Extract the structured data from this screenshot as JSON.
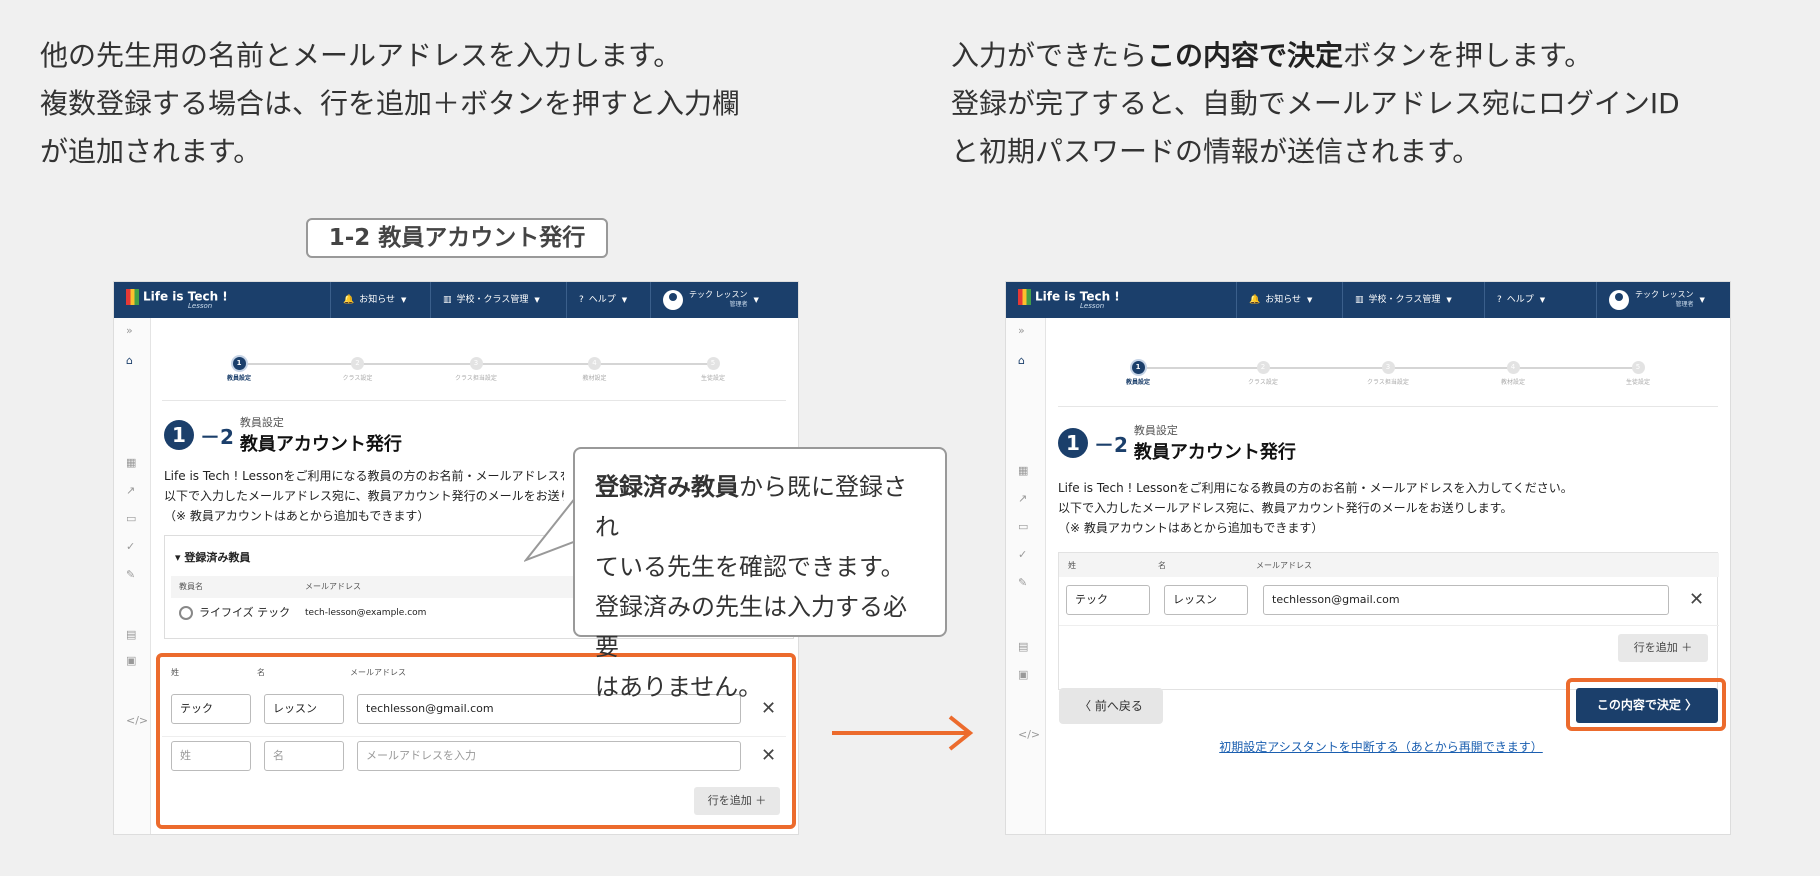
{
  "left_caption": {
    "line1": "他の先生用の名前とメールアドレスを入力します。",
    "line2": "複数登録する場合は、行を追加＋ボタンを押すと入力欄",
    "line3": "が追加されます。"
  },
  "right_caption": {
    "line1_pre": "入力ができたら",
    "line1_bold": "この内容で決定",
    "line1_post": "ボタンを押します。",
    "line2": "登録が完了すると、自動でメールアドレス宛にログインID",
    "line3": "と初期パスワードの情報が送信されます。"
  },
  "section_tag": "1-2 教員アカウント発行",
  "app": {
    "logo_text": "Life is Tech !",
    "logo_sub": "Lesson",
    "nav": {
      "notifications": "お知らせ",
      "school_class": "学校・クラス管理",
      "help": "ヘルプ",
      "user_name": "テック レッスン",
      "user_role": "管理者"
    },
    "steps": [
      {
        "num": "1",
        "label": "教員設定"
      },
      {
        "num": "2",
        "label": "クラス設定"
      },
      {
        "num": "3",
        "label": "クラス担当設定"
      },
      {
        "num": "4",
        "label": "教材設定"
      },
      {
        "num": "5",
        "label": "生徒設定"
      }
    ],
    "heading": {
      "num": "1",
      "dash": "－",
      "num2": "2",
      "sub": "教員設定",
      "title": "教員アカウント発行"
    },
    "desc": {
      "line1": "Life is Tech ! Lessonをご利用になる教員の方のお名前・メールアドレスを入力してください。",
      "line2": "以下で入力したメールアドレス宛に、教員アカウント発行のメールをお送りします。",
      "line3": "（※ 教員アカウントはあとから追加もできます）"
    },
    "registered": {
      "title": "▾ 登録済み教員",
      "col_name": "教員名",
      "col_email": "メールアドレス",
      "row_name": "ライフイズ テック",
      "row_email": "tech-lesson@example.com"
    },
    "form": {
      "col_last": "姓",
      "col_first": "名",
      "col_email": "メールアドレス",
      "row1": {
        "last": "テック",
        "first": "レッスン",
        "email": "techlesson@gmail.com"
      },
      "row2": {
        "last_ph": "姓",
        "first_ph": "名",
        "email_ph": "メールアドレスを入力"
      },
      "add_row": "行を追加 ＋",
      "remove": "✕"
    },
    "back_button": "〈 前へ戻る",
    "confirm_button": "この内容で決定 〉",
    "cancel_link": "初期設定アシスタントを中断する（あとから再開できます）"
  },
  "bubble": {
    "bold": "登録済み教員",
    "text1": "から既に登録され",
    "text2": "ている先生を確認できます。",
    "text3": "登録済みの先生は入力する必要",
    "text4": "はありません。"
  },
  "colors": {
    "navy": "#1b3f6b",
    "orange": "#ec6b2d"
  }
}
